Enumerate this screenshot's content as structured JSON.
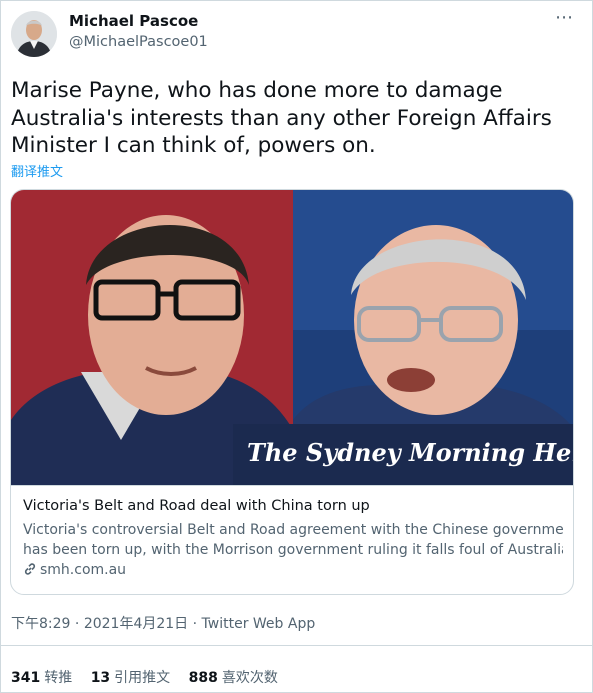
{
  "author": {
    "name": "Michael Pascoe",
    "handle": "@MichaelPascoe01"
  },
  "tweet": {
    "lines": [
      "Marise Payne, who has done more to damage",
      "Australia's interests than any other Foreign Affairs",
      "Minister I can think of, powers on."
    ],
    "translate_label": "翻译推文"
  },
  "card": {
    "image_masthead": "The Sydney Morning Herald",
    "title": "Victoria's Belt and Road deal with China torn up",
    "description_lines": [
      "Victoria's controversial Belt and Road agreement with the Chinese government",
      "has been torn up, with the Morrison government ruling it falls foul of Australia's ..."
    ],
    "domain": "smh.com.au"
  },
  "meta": {
    "time": "下午8:29",
    "date": "2021年4月21日",
    "separator": "·",
    "app": "Twitter Web App"
  },
  "stats": {
    "retweets_count": "341",
    "retweets_label": "转推",
    "quotes_count": "13",
    "quotes_label": "引用推文",
    "likes_count": "888",
    "likes_label": "喜欢次数"
  },
  "icons": {
    "more": "more-dots-icon",
    "link": "link-icon"
  },
  "colors": {
    "link_blue": "#1d9bf0",
    "secondary_text": "#536471",
    "masthead_bg": "#1b2a4f"
  }
}
